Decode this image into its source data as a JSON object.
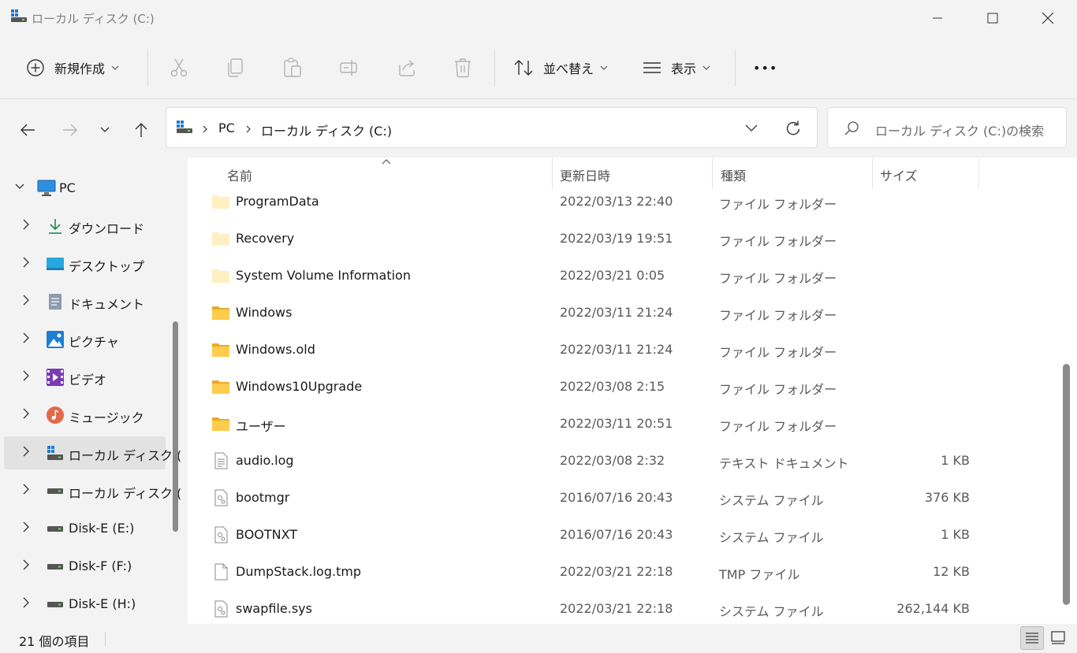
{
  "window": {
    "title": "ローカル ディスク (C:)"
  },
  "toolbar": {
    "new_label": "新規作成",
    "sort_label": "並べ替え",
    "view_label": "表示",
    "more_label": "•••"
  },
  "address": {
    "crumbs": [
      "PC",
      "ローカル ディスク (C:)"
    ]
  },
  "search": {
    "placeholder": "ローカル ディスク (C:)の検索"
  },
  "sidebar": {
    "items": [
      {
        "label": "PC",
        "icon": "pc-icon"
      },
      {
        "label": "ダウンロード",
        "icon": "download-icon"
      },
      {
        "label": "デスクトップ",
        "icon": "desktop-icon"
      },
      {
        "label": "ドキュメント",
        "icon": "documents-icon"
      },
      {
        "label": "ピクチャ",
        "icon": "pictures-icon"
      },
      {
        "label": "ビデオ",
        "icon": "videos-icon"
      },
      {
        "label": "ミュージック",
        "icon": "music-icon"
      },
      {
        "label": "ローカル ディスク (",
        "icon": "system-drive-icon",
        "selected": true
      },
      {
        "label": "ローカル ディスク (",
        "icon": "drive-icon"
      },
      {
        "label": "Disk-E (E:)",
        "icon": "drive-icon"
      },
      {
        "label": "Disk-F (F:)",
        "icon": "drive-icon"
      },
      {
        "label": "Disk-E (H:)",
        "icon": "drive-icon"
      }
    ]
  },
  "columns": {
    "name": "名前",
    "modified": "更新日時",
    "type": "種類",
    "size": "サイズ"
  },
  "files": [
    {
      "name": "ProgramData",
      "date": "2022/03/13 22:40",
      "type": "ファイル フォルダー",
      "size": "",
      "icon": "folder-hidden-icon"
    },
    {
      "name": "Recovery",
      "date": "2022/03/19 19:51",
      "type": "ファイル フォルダー",
      "size": "",
      "icon": "folder-hidden-icon"
    },
    {
      "name": "System Volume Information",
      "date": "2022/03/21 0:05",
      "type": "ファイル フォルダー",
      "size": "",
      "icon": "folder-hidden-icon"
    },
    {
      "name": "Windows",
      "date": "2022/03/11 21:24",
      "type": "ファイル フォルダー",
      "size": "",
      "icon": "folder-icon"
    },
    {
      "name": "Windows.old",
      "date": "2022/03/11 21:24",
      "type": "ファイル フォルダー",
      "size": "",
      "icon": "folder-icon"
    },
    {
      "name": "Windows10Upgrade",
      "date": "2022/03/08 2:15",
      "type": "ファイル フォルダー",
      "size": "",
      "icon": "folder-icon"
    },
    {
      "name": "ユーザー",
      "date": "2022/03/11 20:51",
      "type": "ファイル フォルダー",
      "size": "",
      "icon": "folder-icon"
    },
    {
      "name": "audio.log",
      "date": "2022/03/08 2:32",
      "type": "テキスト ドキュメント",
      "size": "1 KB",
      "icon": "text-file-icon"
    },
    {
      "name": "bootmgr",
      "date": "2016/07/16 20:43",
      "type": "システム ファイル",
      "size": "376 KB",
      "icon": "system-file-icon"
    },
    {
      "name": "BOOTNXT",
      "date": "2016/07/16 20:43",
      "type": "システム ファイル",
      "size": "1 KB",
      "icon": "system-file-icon"
    },
    {
      "name": "DumpStack.log.tmp",
      "date": "2022/03/21 22:18",
      "type": "TMP ファイル",
      "size": "12 KB",
      "icon": "blank-file-icon"
    },
    {
      "name": "swapfile.sys",
      "date": "2022/03/21 22:18",
      "type": "システム ファイル",
      "size": "262,144 KB",
      "icon": "system-file-icon"
    }
  ],
  "status": {
    "count": "21 個の項目"
  }
}
